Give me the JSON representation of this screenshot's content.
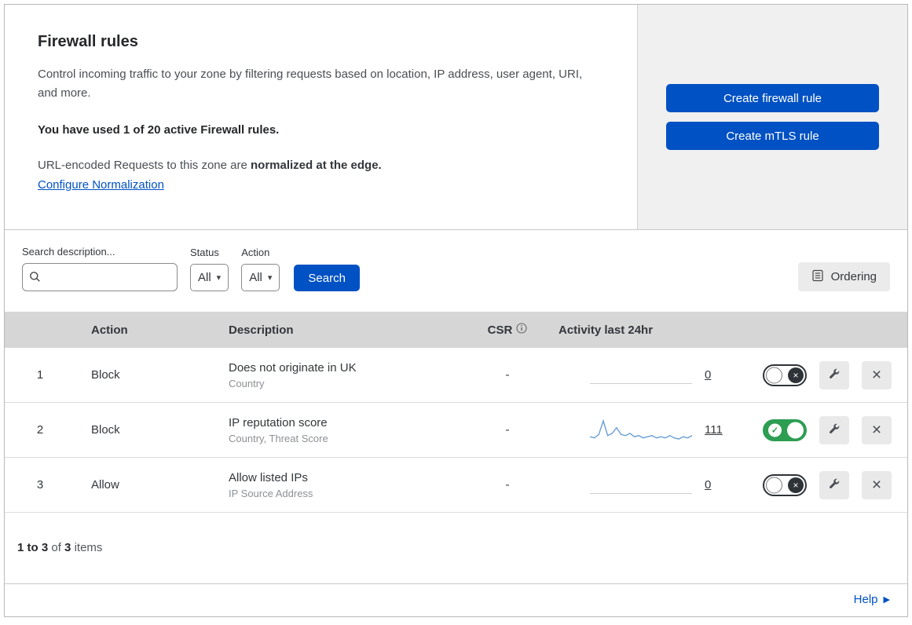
{
  "header": {
    "title": "Firewall rules",
    "description": "Control incoming traffic to your zone by filtering requests based on location, IP address, user agent, URI, and more.",
    "usage": "You have used 1 of 20 active Firewall rules.",
    "normalization_text": "URL-encoded Requests to this zone are ",
    "normalization_bold": "normalized at the edge.",
    "normalization_link": "Configure Normalization",
    "create_firewall_button": "Create firewall rule",
    "create_mtls_button": "Create mTLS rule"
  },
  "filters": {
    "search_label": "Search description...",
    "status_label": "Status",
    "status_value": "All",
    "action_label": "Action",
    "action_value": "All",
    "search_button": "Search",
    "ordering_button": "Ordering"
  },
  "table": {
    "headers": {
      "action": "Action",
      "description": "Description",
      "csr": "CSR",
      "activity": "Activity last 24hr"
    },
    "rows": [
      {
        "index": "1",
        "action": "Block",
        "description": "Does not originate in UK",
        "subtitle": "Country",
        "csr": "-",
        "activity_count": "0",
        "enabled": false,
        "sparkline": []
      },
      {
        "index": "2",
        "action": "Block",
        "description": "IP reputation score",
        "subtitle": "Country, Threat Score",
        "csr": "-",
        "activity_count": "111",
        "enabled": true,
        "sparkline": [
          4,
          3,
          6,
          18,
          5,
          7,
          12,
          6,
          5,
          7,
          4,
          5,
          3,
          4,
          5,
          3,
          4,
          3,
          5,
          3,
          2,
          4,
          3,
          5
        ]
      },
      {
        "index": "3",
        "action": "Allow",
        "description": "Allow listed IPs",
        "subtitle": "IP Source Address",
        "csr": "-",
        "activity_count": "0",
        "enabled": false,
        "sparkline": []
      }
    ]
  },
  "footer": {
    "range": "1 to 3",
    "of": "of",
    "total": "3",
    "items": "items",
    "help_link": "Help"
  },
  "colors": {
    "accent_blue": "#0051c3",
    "toggle_green": "#2d9d52",
    "sparkline": "#6b9fd4",
    "header_gray": "#d6d6d6",
    "panel_gray": "#f0f0f0"
  }
}
